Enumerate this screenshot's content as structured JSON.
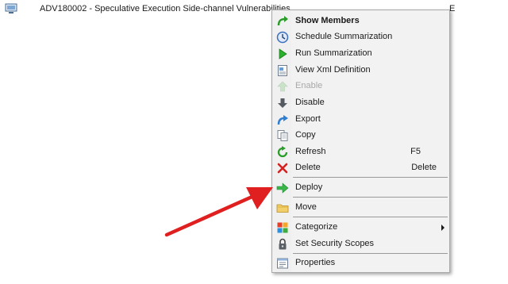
{
  "row": {
    "title": "ADV180002 - Speculative Execution Side-channel Vulnerabilities",
    "clipped_text": "E",
    "icon": "software-update-icon"
  },
  "menu": {
    "items": [
      {
        "label": "Show Members",
        "icon": "green-curved-arrow-icon",
        "bold": true,
        "enabled": true
      },
      {
        "label": "Schedule Summarization",
        "icon": "clock-icon",
        "enabled": true
      },
      {
        "label": "Run Summarization",
        "icon": "green-play-icon",
        "enabled": true
      },
      {
        "label": "View Xml Definition",
        "icon": "xml-document-icon",
        "enabled": true
      },
      {
        "label": "Enable",
        "icon": "up-arrow-icon",
        "enabled": false
      },
      {
        "label": "Disable",
        "icon": "down-arrow-icon",
        "enabled": true
      },
      {
        "label": "Export",
        "icon": "export-arrow-icon",
        "enabled": true
      },
      {
        "label": "Copy",
        "icon": "copy-icon",
        "enabled": true
      },
      {
        "label": "Refresh",
        "icon": "refresh-icon",
        "shortcut": "F5",
        "enabled": true
      },
      {
        "label": "Delete",
        "icon": "red-x-icon",
        "shortcut": "Delete",
        "enabled": true
      },
      {
        "label": "Deploy",
        "icon": "green-right-arrow-icon",
        "enabled": true
      },
      {
        "label": "Move",
        "icon": "folder-icon",
        "enabled": true
      },
      {
        "label": "Categorize",
        "icon": "color-grid-icon",
        "submenu": true,
        "enabled": true
      },
      {
        "label": "Set Security Scopes",
        "icon": "lock-icon",
        "enabled": true
      },
      {
        "label": "Properties",
        "icon": "properties-icon",
        "enabled": true
      }
    ]
  },
  "annotation": {
    "arrow_color": "#e02020",
    "points_to": "Deploy"
  }
}
